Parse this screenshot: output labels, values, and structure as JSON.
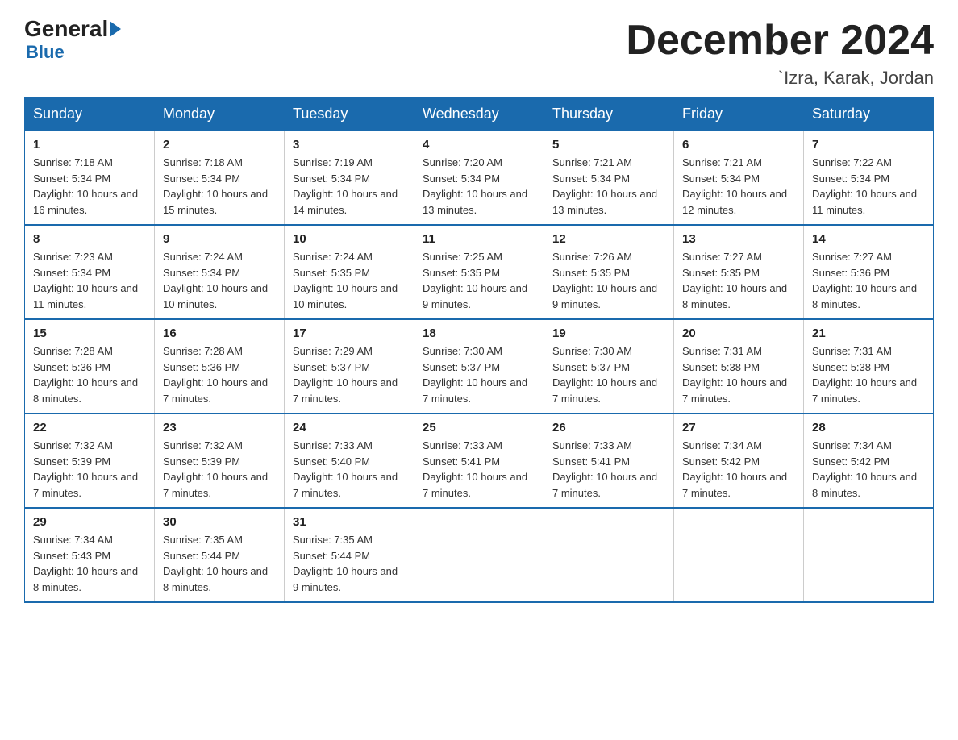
{
  "header": {
    "logo_general": "General",
    "logo_blue": "Blue",
    "month_title": "December 2024",
    "location": "`Izra, Karak, Jordan"
  },
  "days_of_week": [
    "Sunday",
    "Monday",
    "Tuesday",
    "Wednesday",
    "Thursday",
    "Friday",
    "Saturday"
  ],
  "weeks": [
    [
      {
        "day": "1",
        "sunrise": "7:18 AM",
        "sunset": "5:34 PM",
        "daylight": "10 hours and 16 minutes."
      },
      {
        "day": "2",
        "sunrise": "7:18 AM",
        "sunset": "5:34 PM",
        "daylight": "10 hours and 15 minutes."
      },
      {
        "day": "3",
        "sunrise": "7:19 AM",
        "sunset": "5:34 PM",
        "daylight": "10 hours and 14 minutes."
      },
      {
        "day": "4",
        "sunrise": "7:20 AM",
        "sunset": "5:34 PM",
        "daylight": "10 hours and 13 minutes."
      },
      {
        "day": "5",
        "sunrise": "7:21 AM",
        "sunset": "5:34 PM",
        "daylight": "10 hours and 13 minutes."
      },
      {
        "day": "6",
        "sunrise": "7:21 AM",
        "sunset": "5:34 PM",
        "daylight": "10 hours and 12 minutes."
      },
      {
        "day": "7",
        "sunrise": "7:22 AM",
        "sunset": "5:34 PM",
        "daylight": "10 hours and 11 minutes."
      }
    ],
    [
      {
        "day": "8",
        "sunrise": "7:23 AM",
        "sunset": "5:34 PM",
        "daylight": "10 hours and 11 minutes."
      },
      {
        "day": "9",
        "sunrise": "7:24 AM",
        "sunset": "5:34 PM",
        "daylight": "10 hours and 10 minutes."
      },
      {
        "day": "10",
        "sunrise": "7:24 AM",
        "sunset": "5:35 PM",
        "daylight": "10 hours and 10 minutes."
      },
      {
        "day": "11",
        "sunrise": "7:25 AM",
        "sunset": "5:35 PM",
        "daylight": "10 hours and 9 minutes."
      },
      {
        "day": "12",
        "sunrise": "7:26 AM",
        "sunset": "5:35 PM",
        "daylight": "10 hours and 9 minutes."
      },
      {
        "day": "13",
        "sunrise": "7:27 AM",
        "sunset": "5:35 PM",
        "daylight": "10 hours and 8 minutes."
      },
      {
        "day": "14",
        "sunrise": "7:27 AM",
        "sunset": "5:36 PM",
        "daylight": "10 hours and 8 minutes."
      }
    ],
    [
      {
        "day": "15",
        "sunrise": "7:28 AM",
        "sunset": "5:36 PM",
        "daylight": "10 hours and 8 minutes."
      },
      {
        "day": "16",
        "sunrise": "7:28 AM",
        "sunset": "5:36 PM",
        "daylight": "10 hours and 7 minutes."
      },
      {
        "day": "17",
        "sunrise": "7:29 AM",
        "sunset": "5:37 PM",
        "daylight": "10 hours and 7 minutes."
      },
      {
        "day": "18",
        "sunrise": "7:30 AM",
        "sunset": "5:37 PM",
        "daylight": "10 hours and 7 minutes."
      },
      {
        "day": "19",
        "sunrise": "7:30 AM",
        "sunset": "5:37 PM",
        "daylight": "10 hours and 7 minutes."
      },
      {
        "day": "20",
        "sunrise": "7:31 AM",
        "sunset": "5:38 PM",
        "daylight": "10 hours and 7 minutes."
      },
      {
        "day": "21",
        "sunrise": "7:31 AM",
        "sunset": "5:38 PM",
        "daylight": "10 hours and 7 minutes."
      }
    ],
    [
      {
        "day": "22",
        "sunrise": "7:32 AM",
        "sunset": "5:39 PM",
        "daylight": "10 hours and 7 minutes."
      },
      {
        "day": "23",
        "sunrise": "7:32 AM",
        "sunset": "5:39 PM",
        "daylight": "10 hours and 7 minutes."
      },
      {
        "day": "24",
        "sunrise": "7:33 AM",
        "sunset": "5:40 PM",
        "daylight": "10 hours and 7 minutes."
      },
      {
        "day": "25",
        "sunrise": "7:33 AM",
        "sunset": "5:41 PM",
        "daylight": "10 hours and 7 minutes."
      },
      {
        "day": "26",
        "sunrise": "7:33 AM",
        "sunset": "5:41 PM",
        "daylight": "10 hours and 7 minutes."
      },
      {
        "day": "27",
        "sunrise": "7:34 AM",
        "sunset": "5:42 PM",
        "daylight": "10 hours and 7 minutes."
      },
      {
        "day": "28",
        "sunrise": "7:34 AM",
        "sunset": "5:42 PM",
        "daylight": "10 hours and 8 minutes."
      }
    ],
    [
      {
        "day": "29",
        "sunrise": "7:34 AM",
        "sunset": "5:43 PM",
        "daylight": "10 hours and 8 minutes."
      },
      {
        "day": "30",
        "sunrise": "7:35 AM",
        "sunset": "5:44 PM",
        "daylight": "10 hours and 8 minutes."
      },
      {
        "day": "31",
        "sunrise": "7:35 AM",
        "sunset": "5:44 PM",
        "daylight": "10 hours and 9 minutes."
      },
      null,
      null,
      null,
      null
    ]
  ]
}
